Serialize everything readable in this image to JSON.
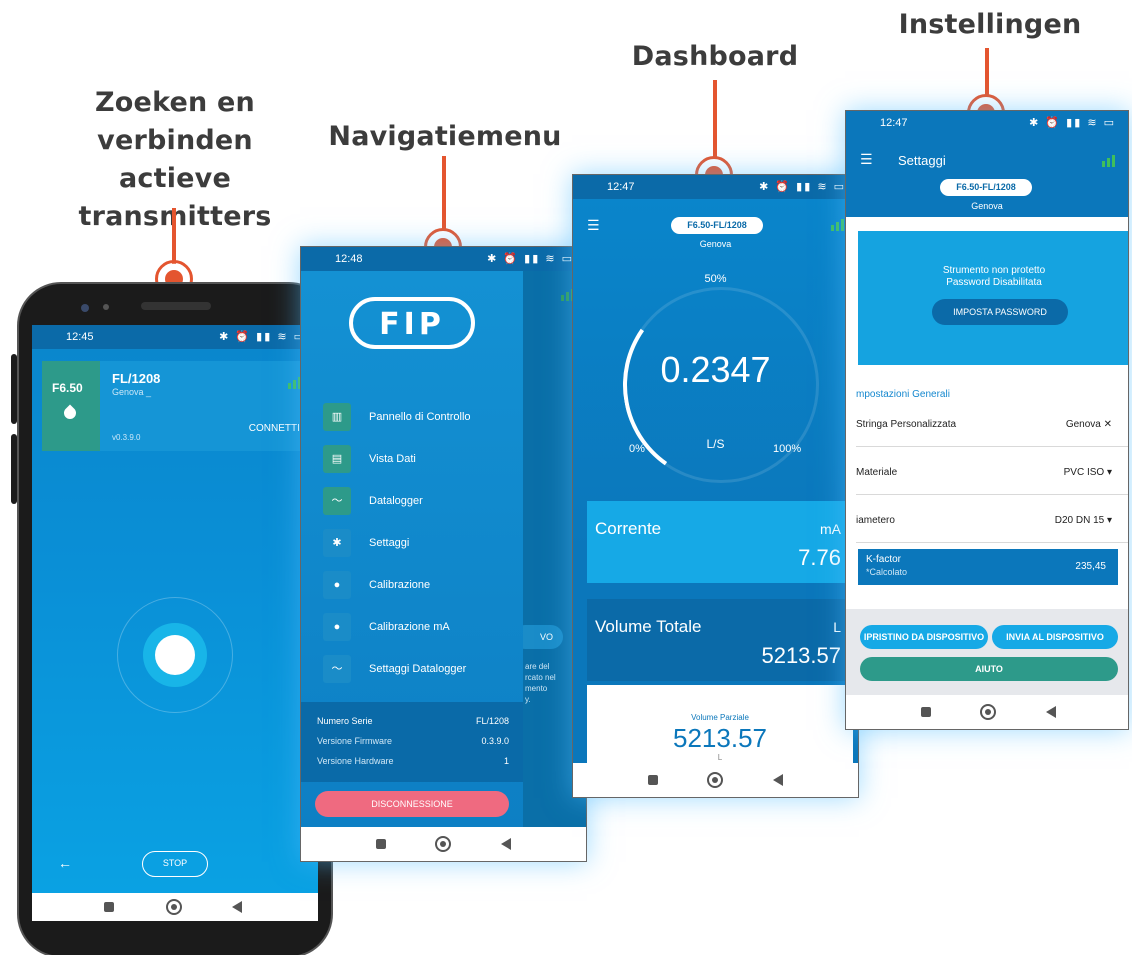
{
  "callouts": {
    "search": [
      "Zoeken en",
      "verbinden actieve",
      "transmitters"
    ],
    "nav": "Navigatiemenu",
    "dashboard": "Dashboard",
    "settings": "Instellingen"
  },
  "screen1": {
    "time": "12:45",
    "device_model": "F6.50",
    "device_name": "FL/1208",
    "device_location": "Genova _",
    "firmware": "v0.3.9.0",
    "connect": "CONNETTI",
    "stop": "STOP"
  },
  "screen2": {
    "time": "12:48",
    "logo": "FIP",
    "menu": [
      {
        "label": "Pannello di Controllo",
        "icon": "bar-chart-icon"
      },
      {
        "label": "Vista Dati",
        "icon": "document-icon"
      },
      {
        "label": "Datalogger",
        "icon": "line-chart-icon"
      },
      {
        "label": "Settaggi",
        "icon": "gear-icon"
      },
      {
        "label": "Calibrazione",
        "icon": "calibration-icon"
      },
      {
        "label": "Calibrazione mA",
        "icon": "calibration-ma-icon"
      },
      {
        "label": "Settaggi Datalogger",
        "icon": "line-chart-icon"
      }
    ],
    "info": {
      "serial_label": "Numero Serie",
      "serial": "FL/1208",
      "fw_label": "Versione Firmware",
      "fw": "0.3.9.0",
      "hw_label": "Versione Hardware",
      "hw": "1"
    },
    "behind_button": "VO",
    "behind_text": [
      "are del",
      "rcato nel",
      "mento",
      "y."
    ],
    "disconnect": "DISCONNESSIONE"
  },
  "screen3": {
    "time": "12:47",
    "device": "F6.50-FL/1208",
    "location": "Genova",
    "gauge_pct": "50%",
    "value": "0.2347",
    "unit": "L/S",
    "min": "0%",
    "max": "100%",
    "current_label": "Corrente",
    "current_unit": "mA",
    "current_value": "7.76",
    "total_label": "Volume Totale",
    "total_unit": "L",
    "total_value": "5213.57",
    "partial_label": "Volume Parziale",
    "partial_value": "5213.57",
    "partial_unit": "L"
  },
  "screen4": {
    "time": "12:47",
    "title": "Settaggi",
    "device": "F6.50-FL/1208",
    "location": "Genova",
    "msg1": "Strumento non protetto",
    "msg2": "Password Disabilitata",
    "set_password": "IMPOSTA PASSWORD",
    "section": "mpostazioni Generali",
    "fields": [
      {
        "key": "Stringa Personalizzata",
        "value": "Genova ✕"
      },
      {
        "key": "Materiale",
        "value": "PVC ISO ▾"
      },
      {
        "key": "iametero",
        "value": "D20 DN 15 ▾"
      }
    ],
    "kfactor_label": "K-factor",
    "kfactor_sub": "*Calcolato",
    "kfactor_value": "235,45",
    "restore": "IPRISTINO DA DISPOSITIVO",
    "send": "INVIA AL DISPOSITIVO",
    "help": "AIUTO"
  },
  "colors": {
    "accent": "#e4552f",
    "primary": "#0b77bb",
    "light": "#16a9e6",
    "disconnect": "#ef6a80"
  }
}
